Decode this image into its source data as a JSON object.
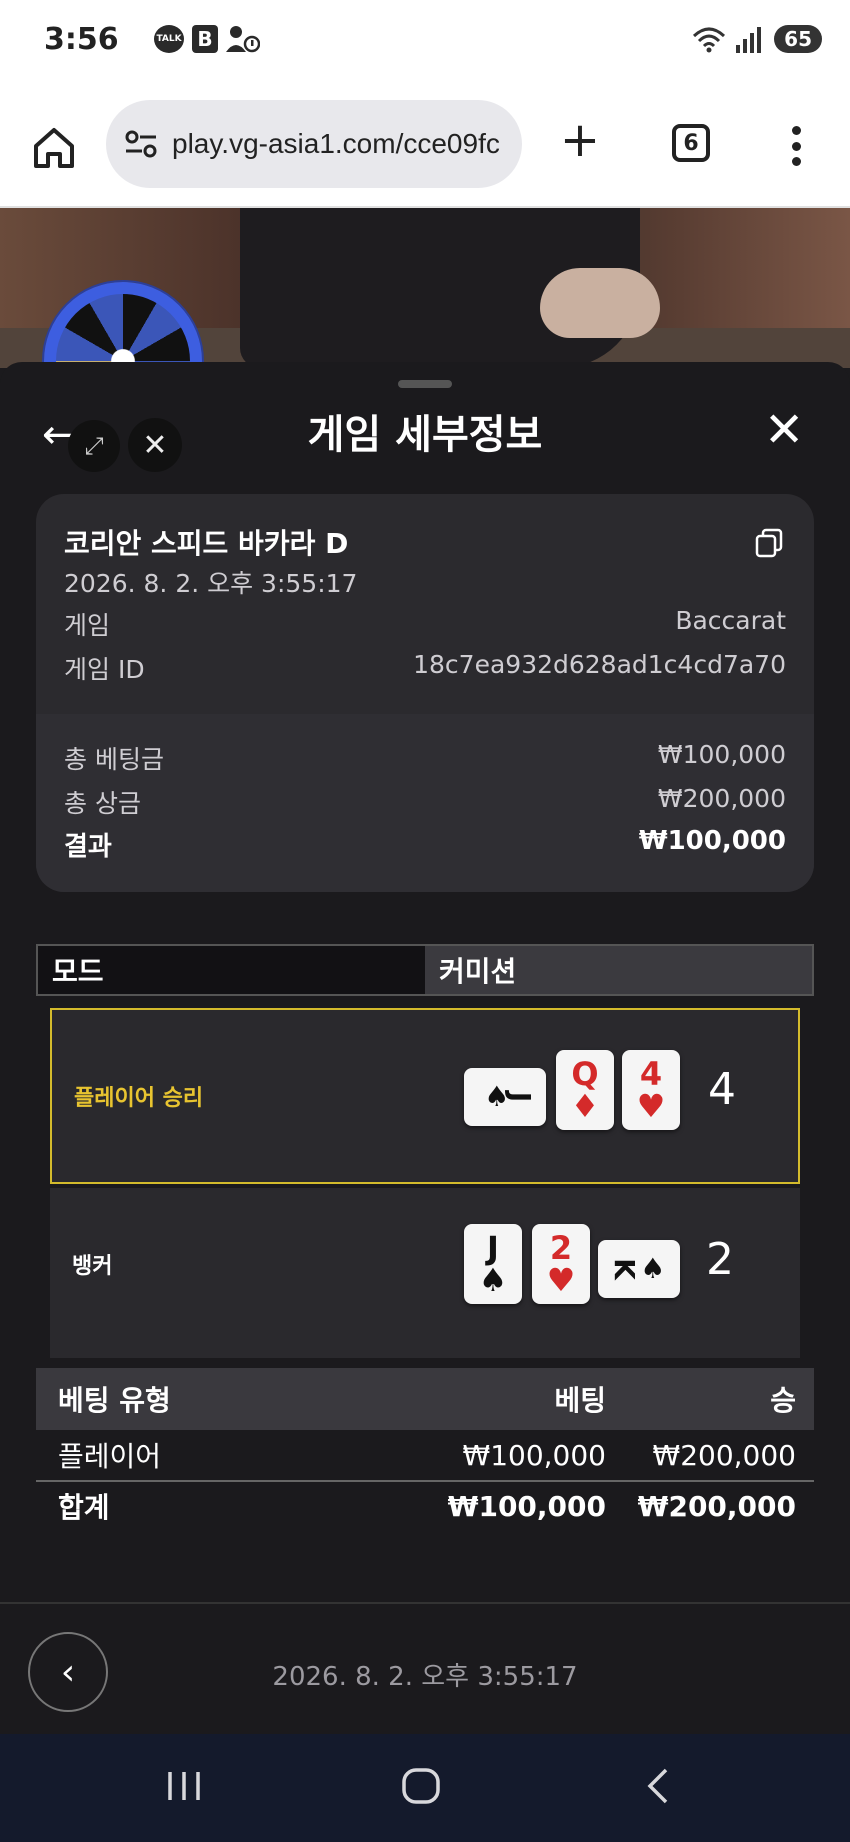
{
  "status": {
    "time": "3:56",
    "talk_badge": "TALK",
    "b_badge": "B",
    "battery": "65"
  },
  "browser": {
    "url": "play.vg-asia1.com/cce09fc",
    "tab_count": "6"
  },
  "sheet": {
    "title": "게임 세부정보"
  },
  "info": {
    "game_name": "코리안 스피드 바카라 D",
    "date": "2026. 8. 2. 오후 3:55:17",
    "game_label": "게임",
    "game_value": "Baccarat",
    "game_id_label": "게임 ID",
    "game_id_value": "18c7ea932d628ad1c4cd7a70",
    "total_bet_label": "총 베팅금",
    "total_bet_value": "₩100,000",
    "total_prize_label": "총 상금",
    "total_prize_value": "₩200,000",
    "result_label": "결과",
    "result_value": "₩100,000"
  },
  "mode": {
    "mode_label": "모드",
    "mode_value": "커미션"
  },
  "hands": {
    "player": {
      "label": "플레이어 승리",
      "score": "4",
      "cards": [
        {
          "rank": "J",
          "suit": "♠",
          "color": "black",
          "rotated": true
        },
        {
          "rank": "Q",
          "suit": "♦",
          "color": "red",
          "rotated": false
        },
        {
          "rank": "4",
          "suit": "♥",
          "color": "red",
          "rotated": false
        }
      ]
    },
    "banker": {
      "label": "뱅커",
      "score": "2",
      "cards": [
        {
          "rank": "J",
          "suit": "♠",
          "color": "black",
          "rotated": false
        },
        {
          "rank": "2",
          "suit": "♥",
          "color": "red",
          "rotated": false
        },
        {
          "rank": "K",
          "suit": "♠",
          "color": "black",
          "rotated": true
        }
      ]
    }
  },
  "bets": {
    "headers": [
      "베팅 유형",
      "베팅",
      "승"
    ],
    "rows": [
      {
        "type": "플레이어",
        "bet": "₩100,000",
        "win": "₩200,000"
      }
    ],
    "total": {
      "type": "합계",
      "bet": "₩100,000",
      "win": "₩200,000"
    }
  },
  "footer": {
    "date": "2026. 8. 2. 오후 3:55:17"
  },
  "colors": {
    "winner_border": "#d4bb2c",
    "winner_label": "#e8c430",
    "sheet_bg": "#1b1a1d",
    "card_red": "#d42a2a"
  }
}
